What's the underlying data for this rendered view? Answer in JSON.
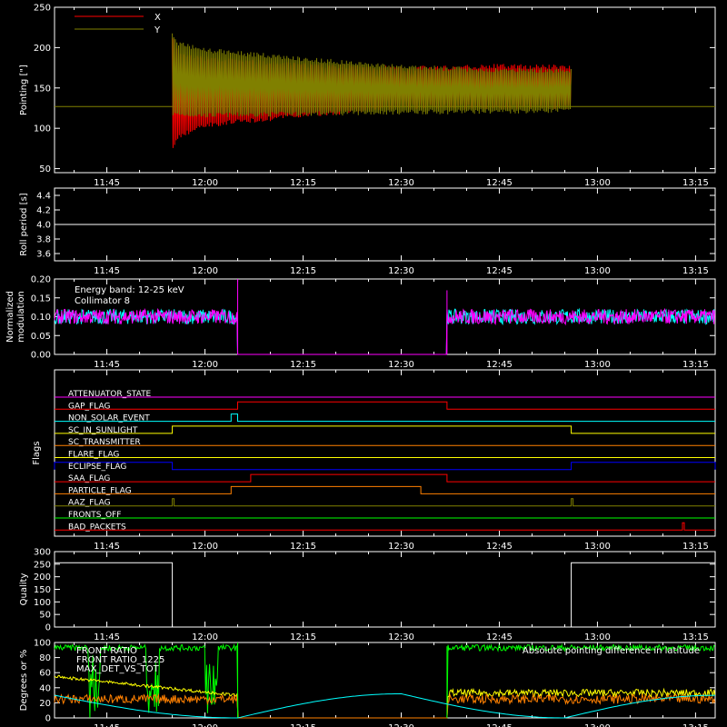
{
  "time_ticks": [
    "11:45",
    "12:00",
    "12:15",
    "12:30",
    "12:45",
    "13:00",
    "13:15"
  ],
  "colors": {
    "x": "#ff0000",
    "y": "#808000",
    "cyan": "#00ffff",
    "magenta": "#ff00ff",
    "green": "#00ff00",
    "yellow": "#ffff00",
    "orange": "#ff8000",
    "blue": "#0000ff",
    "white": "#ffffff"
  },
  "chart_data": [
    {
      "type": "line",
      "ylabel": "Pointing [\"]",
      "ylim": [
        45,
        250
      ],
      "yticks": [
        "250",
        "200",
        "150",
        "100",
        "50"
      ],
      "xlim": [
        "11:37",
        "13:18"
      ],
      "legend": [
        "X",
        "Y"
      ],
      "reference_line": 127,
      "series": [
        {
          "name": "X",
          "x": [
            "11:55",
            "11:56",
            "12:00",
            "12:15",
            "12:30",
            "12:45",
            "12:56"
          ],
          "upper": [
            215,
            190,
            186,
            178,
            174,
            177,
            176
          ],
          "lower": [
            75,
            90,
            104,
            116,
            126,
            127,
            126
          ]
        },
        {
          "name": "Y",
          "x": [
            "11:55",
            "11:56",
            "12:00",
            "12:15",
            "12:30",
            "12:45",
            "12:56"
          ],
          "upper": [
            215,
            205,
            197,
            186,
            176,
            172,
            172
          ],
          "lower": [
            118,
            117,
            116,
            118,
            120,
            121,
            122
          ]
        }
      ]
    },
    {
      "type": "line",
      "ylabel": "Roll period [s]",
      "ylim": [
        3.5,
        4.5
      ],
      "yticks": [
        "4.4",
        "4.2",
        "4.0",
        "3.8",
        "3.6"
      ],
      "series": [
        {
          "x": [
            "11:37",
            "13:18"
          ],
          "values": [
            4.0,
            4.0
          ]
        }
      ]
    },
    {
      "type": "line",
      "ylabel": "Normalized modulation",
      "ylim": [
        0,
        0.2
      ],
      "yticks": [
        "0.20",
        "0.15",
        "0.10",
        "0.05",
        "0.00"
      ],
      "annotations": [
        "Energy band: 12-25 keV",
        "Collimator 8"
      ],
      "gaps": [
        [
          "12:05",
          "12:37"
        ]
      ],
      "series": [
        {
          "name": "Collimator 8",
          "mean": 0.1,
          "spread": 0.02
        },
        {
          "mean": 0.1,
          "spread": 0.02
        }
      ]
    },
    {
      "type": "line",
      "ylabel": "Flags",
      "flags": [
        {
          "name": "ATTENUATOR_STATE",
          "color": "#ff00ff",
          "high": []
        },
        {
          "name": "GAP_FLAG",
          "color": "#ff0000",
          "high": [
            [
              "12:05",
              "12:37"
            ]
          ]
        },
        {
          "name": "NON_SOLAR_EVENT",
          "color": "#00ffff",
          "high": [
            [
              "12:04",
              "12:05"
            ]
          ]
        },
        {
          "name": "SC_IN_SUNLIGHT",
          "color": "#ffff00",
          "high": [
            [
              "11:55",
              "12:56"
            ]
          ]
        },
        {
          "name": "SC_TRANSMITTER",
          "color": "#ff8000",
          "high": []
        },
        {
          "name": "FLARE_FLAG",
          "color": "#ffff00",
          "high": []
        },
        {
          "name": "ECLIPSE_FLAG",
          "color": "#0000ff",
          "high": [
            [
              "11:37",
              "11:55"
            ],
            [
              "12:56",
              "13:18"
            ]
          ]
        },
        {
          "name": "SAA_FLAG",
          "color": "#ff0000",
          "high": [
            [
              "12:07",
              "12:37"
            ]
          ]
        },
        {
          "name": "PARTICLE_FLAG",
          "color": "#ff8000",
          "high": [
            [
              "12:04",
              "12:33"
            ]
          ]
        },
        {
          "name": "AAZ_FLAG",
          "color": "#808000",
          "high": [
            [
              "11:55",
              "11:55"
            ],
            [
              "12:56",
              "12:56"
            ]
          ]
        },
        {
          "name": "FRONTS_OFF",
          "color": "#00ff00",
          "high": []
        },
        {
          "name": "BAD_PACKETS",
          "color": "#ff0000",
          "high": [
            [
              "13:13",
              "13:13"
            ]
          ]
        }
      ]
    },
    {
      "type": "line",
      "ylabel": "Quality",
      "ylim": [
        0,
        300
      ],
      "yticks": [
        "300",
        "250",
        "200",
        "150",
        "100",
        "50",
        "0"
      ],
      "series": [
        {
          "x": [
            "11:37",
            "11:55",
            "11:55",
            "12:56",
            "12:56",
            "13:18"
          ],
          "values": [
            256,
            256,
            0,
            0,
            256,
            256
          ]
        }
      ]
    },
    {
      "type": "line",
      "ylabel": "Degrees or %",
      "ylim": [
        0,
        100
      ],
      "yticks": [
        "100",
        "80",
        "60",
        "40",
        "20",
        "0"
      ],
      "legend": [
        "FRONT RATIO",
        "FRONT RATIO_1225",
        "MAX_DET_VS_TOT"
      ],
      "extra_label": "Absolute pointing difference in latitude",
      "series": [
        {
          "name": "FRONT RATIO",
          "gaps": [
            [
              "12:05",
              "12:37"
            ]
          ],
          "level": 93
        },
        {
          "name": "FRONT RATIO_1225",
          "gaps": [
            [
              "12:05",
              "12:37"
            ]
          ],
          "level": 33
        },
        {
          "name": "MAX_DET_VS_TOT",
          "gaps": [
            [
              "12:05",
              "12:37"
            ]
          ],
          "level": 25
        },
        {
          "name": "Absolute pointing difference in latitude",
          "x": [
            "11:37",
            "12:05",
            "12:30",
            "12:55",
            "13:18"
          ],
          "values": [
            30,
            0,
            32,
            0,
            30
          ]
        }
      ]
    }
  ]
}
